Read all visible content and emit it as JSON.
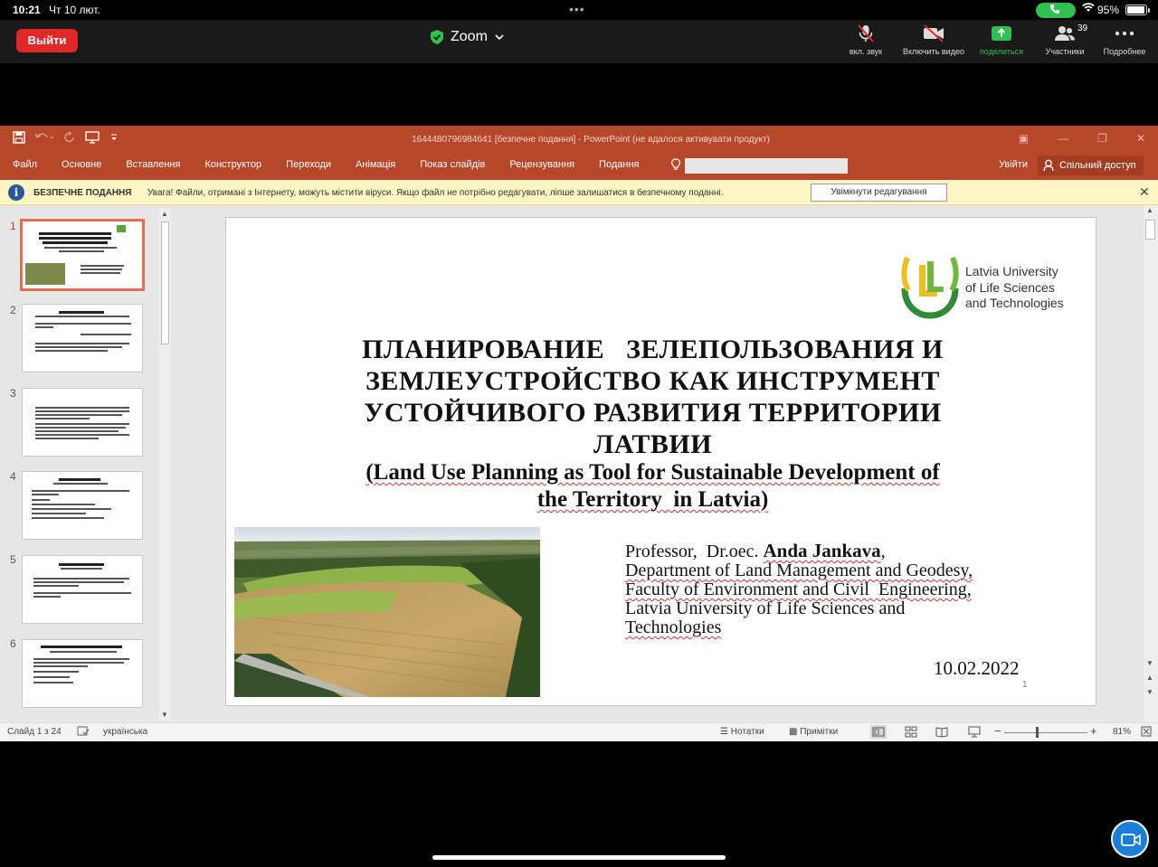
{
  "status_bar": {
    "time": "10:21",
    "date": "Чт 10 лют.",
    "battery": "95%"
  },
  "zoom": {
    "leave_label": "Выйти",
    "app_title": "Zoom",
    "tools": [
      {
        "icon": "mic-muted-icon",
        "label": "вкл. звук"
      },
      {
        "icon": "video-off-icon",
        "label": "Включить видео"
      },
      {
        "icon": "share-screen-icon",
        "label": "поделиться"
      },
      {
        "icon": "participants-icon",
        "label": "Участники"
      },
      {
        "icon": "more-icon",
        "label": "Подробнее"
      }
    ],
    "participants_count": "39",
    "accent_color": "#30c04f",
    "leave_color": "#e02828"
  },
  "powerpoint": {
    "doc_title": "1644480796984641 [безпечне подання] - PowerPoint (не вдалося активувати продукт)",
    "tabs": [
      "Файл",
      "Основне",
      "Вставлення",
      "Конструктор",
      "Переходи",
      "Анімація",
      "Показ слайдів",
      "Рецензування",
      "Подання"
    ],
    "signin": "Увійти",
    "share": "Спільний доступ",
    "brand_color": "#b7472a",
    "message_bar": {
      "title": "БЕЗПЕЧНЕ ПОДАННЯ",
      "text": "Увага! Файли, отримані з Інтернету, можуть містити віруси. Якщо файл не потрібно редагувати, ліпше залишатися в безпечному поданні.",
      "button": "Увімкнути редагування"
    },
    "thumbnails": [
      "1",
      "2",
      "3",
      "4",
      "5",
      "6"
    ],
    "slide": {
      "university_lines": [
        "Latvia University",
        "of Life Sciences",
        "and Technologies"
      ],
      "title_ru_lines": [
        "ПЛАНИРОВАНИЕ   ЗЕЛЕПОЛЬЗОВАНИЯ И",
        "ЗЕМЛЕУСТРОЙСТВО КАК ИНСТРУМЕНТ",
        "УСТОЙЧИВОГО РАЗВИТИЯ ТЕРРИТОРИИ",
        "ЛАТВИИ"
      ],
      "title_en_lines": [
        "(Land Use Planning as Tool for Sustainable Development of",
        "the Territory  in Latvia)"
      ],
      "author_prefix": "Professor,  Dr.oec. ",
      "author_name": "Anda Jankava",
      "author_suffix": ",",
      "affiliation_lines": [
        "Department of Land Management and Geodesy,",
        "Faculty of Environment and Civil  Engineering,",
        "Latvia University of Life Sciences and",
        "Technologies"
      ],
      "date": "10.02.2022",
      "number": "1"
    },
    "statusbar": {
      "slide_info": "Слайд 1 з 24",
      "language": "українська",
      "notes": "Нотатки",
      "comments": "Примітки",
      "zoom": "81%"
    }
  }
}
